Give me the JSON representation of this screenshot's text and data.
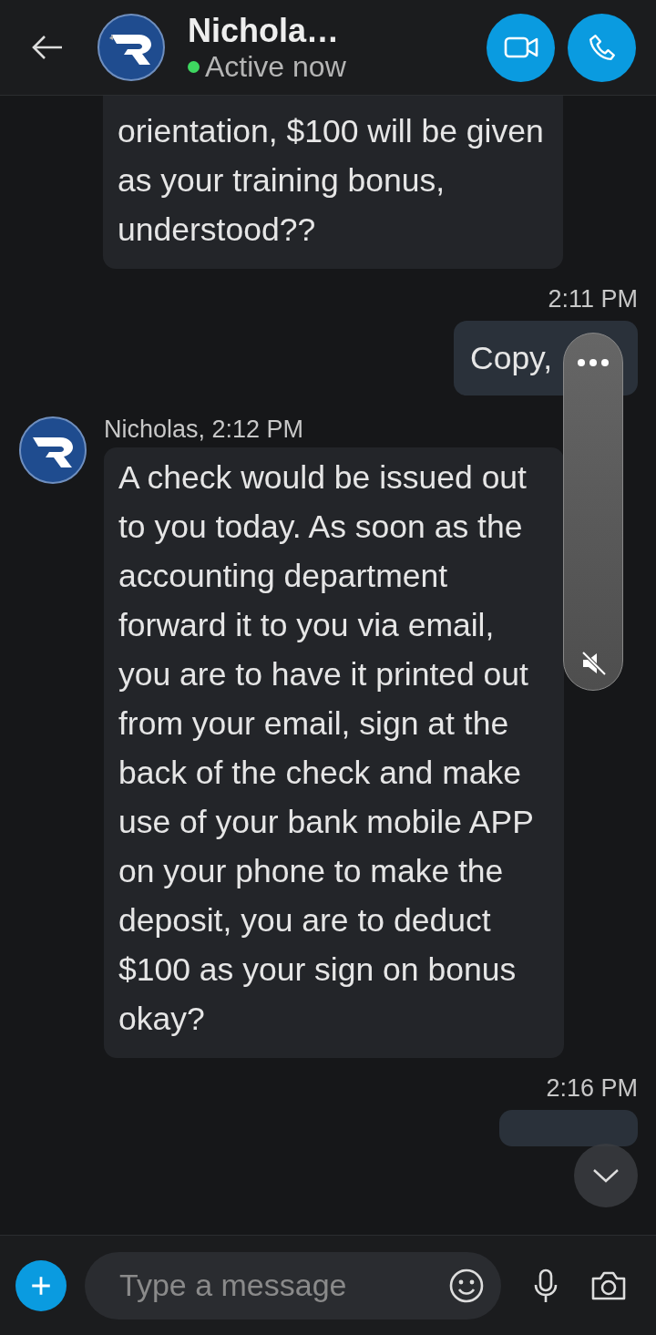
{
  "header": {
    "name": "Nichola…",
    "status": "Active now",
    "online": true
  },
  "messages": [
    {
      "kind": "incoming",
      "text": "orientation, $100 will be given as your training bonus, understood??"
    },
    {
      "kind": "timestamp",
      "text": "2:11 PM"
    },
    {
      "kind": "outgoing",
      "text": "Copy,"
    },
    {
      "kind": "incoming",
      "sender": "Nicholas, 2:12 PM",
      "text": "A check would be issued out to you today. As soon as the accounting department forward it to you via email, you are to have it printed out from your email, sign at the back of the check and make use of your bank mobile APP on your phone to make the deposit, you are to deduct $100 as your sign on bonus okay?"
    },
    {
      "kind": "timestamp",
      "text": "2:16 PM"
    },
    {
      "kind": "outgoing"
    }
  ],
  "composer": {
    "placeholder": "Type a message"
  }
}
